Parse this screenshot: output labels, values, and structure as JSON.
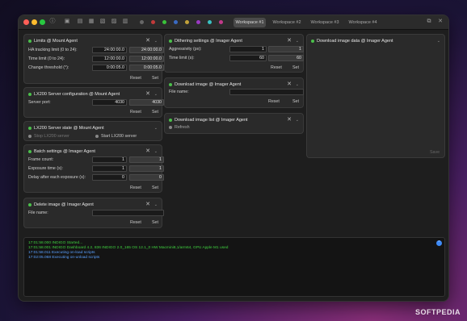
{
  "titlebar": {
    "tabs": [
      "Workspace #1",
      "Workspace #2",
      "Workspace #3",
      "Workspace #4"
    ],
    "active_tab": "Workspace #1",
    "status_colors": [
      "#666666",
      "#c23a3a",
      "#3ac23a",
      "#3a6ac2",
      "#c2a23a",
      "#9a3ac2",
      "#3ac2c2",
      "#c23a8a"
    ]
  },
  "panels": {
    "limits": {
      "title": "Limits @ Mount Agent",
      "rows": [
        {
          "label": "HA tracking limit (0 to 24):",
          "value": "24:00:00.0",
          "current": "24:00:00.0"
        },
        {
          "label": "Time limit (0 to 24):",
          "value": "12:00:00.0",
          "current": "12:00:00.0"
        },
        {
          "label": "Change threshold (°):",
          "value": "0:00:05.0",
          "current": "0:00:05.0"
        }
      ],
      "reset": "Reset",
      "set": "Set"
    },
    "lx200_config": {
      "title": "LX200 Server configuration @ Mount Agent",
      "port_label": "Server port:",
      "port_value": "4030",
      "port_current": "4030",
      "reset": "Reset",
      "set": "Set"
    },
    "lx200_state": {
      "title": "LX200 Server state @ Mount Agent",
      "stop": "Stop LX200 server",
      "start": "Start LX200 server"
    },
    "batch": {
      "title": "Batch settings @ Imager Agent",
      "rows": [
        {
          "label": "Frame count:",
          "value": "1",
          "current": "1"
        },
        {
          "label": "Exposure time (s):",
          "value": "1",
          "current": "1"
        },
        {
          "label": "Delay after each exposure (s):",
          "value": "0",
          "current": "0"
        }
      ],
      "reset": "Reset",
      "set": "Set"
    },
    "delete_image": {
      "title": "Delete image @ Imager Agent",
      "file_label": "File name:",
      "file_value": "",
      "reset": "Reset",
      "set": "Set"
    },
    "dithering": {
      "title": "Dithering settings @ Imager Agent",
      "rows": [
        {
          "label": "Aggressivity (px):",
          "value": "1",
          "current": "1"
        },
        {
          "label": "Time limit (s):",
          "value": "60",
          "current": "60"
        }
      ],
      "reset": "Reset",
      "set": "Set"
    },
    "download_image": {
      "title": "Download image @ Imager Agent",
      "file_label": "File name:",
      "file_value": "",
      "reset": "Reset",
      "set": "Set"
    },
    "image_list": {
      "title": "Download image list @ Imager Agent",
      "refresh": "Refresh"
    },
    "image_data": {
      "title": "Download image data @ Imager Agent",
      "save": "Save"
    }
  },
  "log": {
    "lines": [
      {
        "text": "17:01:58.000 INDIGO Started...",
        "color": "#3fd03f"
      },
      {
        "text": "17:01:58.001 INDIGO Dashboard 4.2, 836 INDIGO 2.0_165 OS 12.1_0 HW Macmini8,1/arm64, GPU Apple M1 used",
        "color": "#3fd03f"
      },
      {
        "text": "17:01:58.011 Executing on-load scripts",
        "color": "#5aa0ff"
      },
      {
        "text": "17:02:05.068 Executing on-unload scripts",
        "color": "#5aa0ff"
      }
    ]
  },
  "watermark": "SOFTPEDIA"
}
